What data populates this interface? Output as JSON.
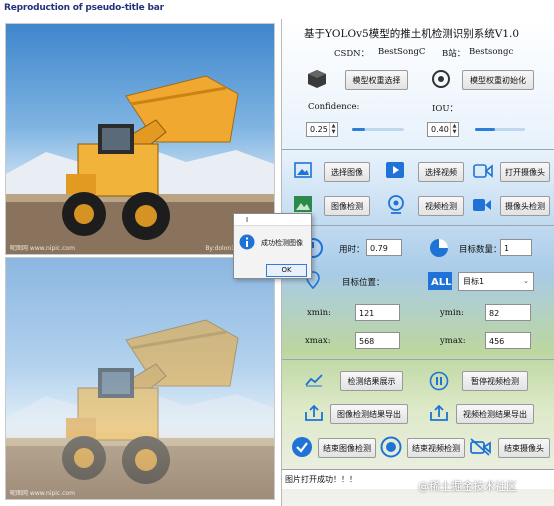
{
  "window": {
    "title": "Reproduction of pseudo-title bar"
  },
  "right": {
    "system_title": "基于YOLOv5模型的推土机检测识别系统V1.0",
    "csdn_label": "CSDN：",
    "csdn_value": "BestSongC",
    "bili_label": "B站：",
    "bili_value": "Bestsongc",
    "btn_select_weights": "模型权重选择",
    "btn_init_model": "模型权重初始化",
    "confidence_label": "Confidence:",
    "confidence_value": "0.25",
    "confidence_fraction": 0.25,
    "iou_label": "IOU：",
    "iou_value": "0.40",
    "iou_fraction": 0.4,
    "btn_select_image": "选择图像",
    "btn_select_video": "选择视频",
    "btn_open_camera": "打开摄像头",
    "btn_image_detect": "图像检测",
    "btn_video_detect": "视频检测",
    "btn_camera_detect": "摄像头检测",
    "time_label": "用时：",
    "time_value": "0.79",
    "count_label": "目标数量：",
    "count_value": "1",
    "pos_label": "目标位置：",
    "target_select": "目标1",
    "xmin_label": "xmin:",
    "xmin_value": "121",
    "ymin_label": "ymin:",
    "ymin_value": "82",
    "xmax_label": "xmax:",
    "xmax_value": "568",
    "ymax_label": "ymax:",
    "ymax_value": "456",
    "btn_show_result": "检测结果展示",
    "btn_pause_video": "暂停视频检测",
    "btn_export_image": "图像检测结果导出",
    "btn_export_video": "视频检测结果导出",
    "btn_end_image": "结束图像检测",
    "btn_end_video": "结束视频检测",
    "btn_end_camera": "结束摄像头",
    "status": "图片打开成功！！！"
  },
  "dialog": {
    "title": "I",
    "message": "成功检测图像",
    "ok": "OK"
  },
  "image_watermarks": {
    "left": "昵图网 www.nipic.com",
    "right": "By:dolon123 No:2020"
  },
  "page_watermark": "@稀土掘金技术社区",
  "colors": {
    "accent": "#2b7fd8",
    "dialog_info": "#1f73d6"
  }
}
